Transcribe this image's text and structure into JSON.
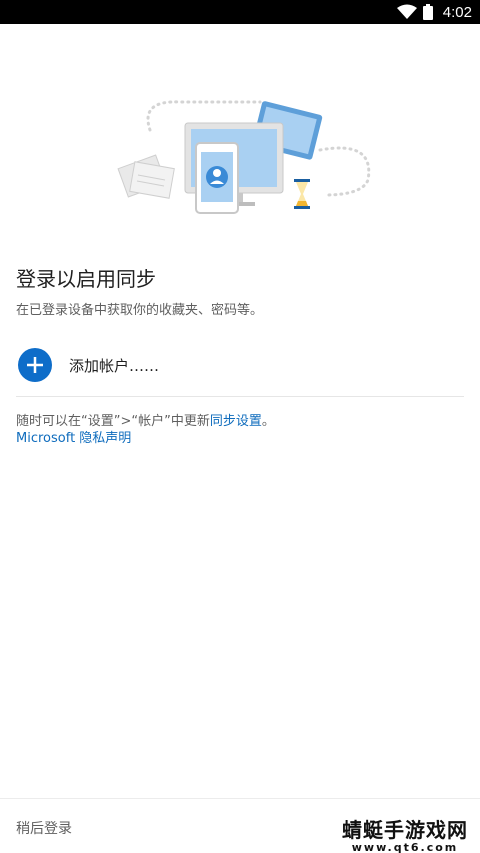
{
  "status_bar": {
    "time": "4:02",
    "wifi_icon": "wifi-icon",
    "battery_icon": "battery-icon"
  },
  "hero": {
    "icon": "sync-devices-illustration"
  },
  "main": {
    "title": "登录以启用同步",
    "subtitle": "在已登录设备中获取你的收藏夹、密码等。"
  },
  "add_account": {
    "label": "添加帐户……",
    "icon": "plus-icon"
  },
  "footnote": {
    "prefix": "随时可以在“设置”>“帐户”中更新",
    "link": "同步设置",
    "suffix": "。",
    "privacy_link": "Microsoft 隐私声明"
  },
  "bottom": {
    "later_label": "稍后登录"
  },
  "watermark": {
    "text": "蜻蜓手游戏网",
    "url": "www.qt6.com"
  },
  "colors": {
    "accent": "#0e6dc9",
    "link": "#0f6cbd",
    "status_bar": "#000000"
  }
}
